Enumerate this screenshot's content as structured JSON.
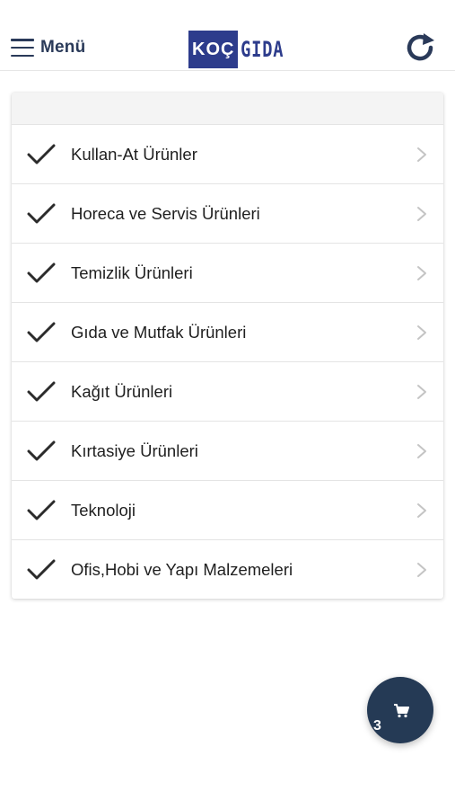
{
  "header": {
    "menu_label": "Menü",
    "logo_box": "KOÇ",
    "logo_text": "GIDA"
  },
  "categories": [
    {
      "label": "Kullan-At Ürünler"
    },
    {
      "label": "Horeca ve Servis Ürünleri"
    },
    {
      "label": "Temizlik Ürünleri"
    },
    {
      "label": "Gıda ve Mutfak Ürünleri"
    },
    {
      "label": "Kağıt Ürünleri"
    },
    {
      "label": "Kırtasiye Ürünleri"
    },
    {
      "label": "Teknoloji"
    },
    {
      "label": "Ofis,Hobi ve Yapı Malzemeleri"
    }
  ],
  "cart": {
    "count": "3"
  },
  "colors": {
    "brand": "#2d3c8c",
    "nav_text": "#2a3a59",
    "fab": "#253a55"
  }
}
